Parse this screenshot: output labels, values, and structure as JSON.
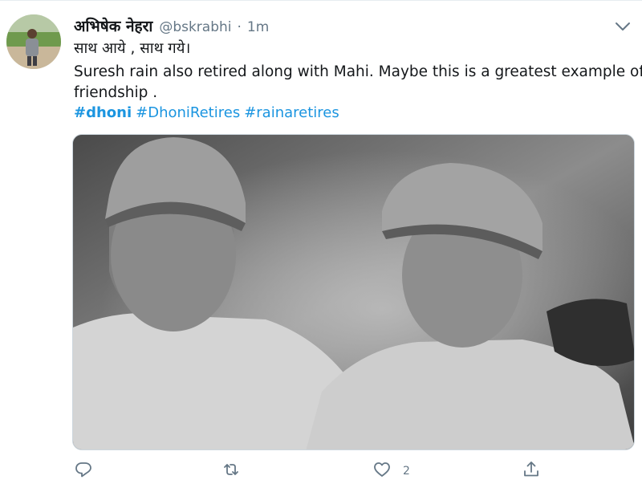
{
  "tweet": {
    "display_name": "अभिषेक नेहरा",
    "handle": "@bskrabhi",
    "separator": "·",
    "time": "1m",
    "text_line1": "साथ आये , साथ गये।",
    "text_line2": "Suresh rain also retired along with Mahi. Maybe this is a greatest example of",
    "text_line3": "friendship .",
    "hashtags": [
      "#dhoni",
      "#DhoniRetires",
      "#rainaretires"
    ]
  },
  "actions": {
    "reply_count": "",
    "retweet_count": "",
    "like_count": "2",
    "share_count": ""
  },
  "colors": {
    "link": "#1b95e0",
    "secondary_text": "#657786",
    "border": "#e6ecf0"
  },
  "icons": [
    "chevron-down-icon",
    "reply-icon",
    "retweet-icon",
    "like-icon",
    "share-icon"
  ]
}
